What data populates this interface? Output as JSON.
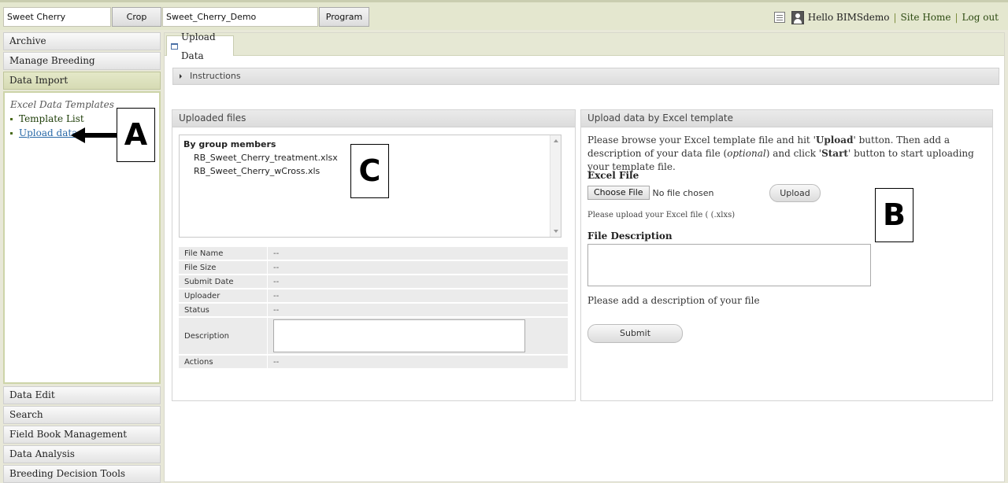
{
  "topbar": {
    "crop_value": "Sweet Cherry",
    "crop_button": "Crop",
    "program_value": "Sweet_Cherry_Demo",
    "program_button": "Program",
    "greeting": "Hello BIMSdemo",
    "separator": "|",
    "site_home": "Site Home",
    "log_out": "Log out"
  },
  "sidebar": {
    "archive": "Archive",
    "manage_breeding": "Manage Breeding",
    "data_import": "Data Import",
    "panel_title": "Excel Data Templates",
    "template_list": "Template List",
    "upload_data": "Upload data",
    "data_edit": "Data Edit",
    "search": "Search",
    "field_book": "Field Book Management",
    "data_analysis": "Data Analysis",
    "breeding_decision": "Breeding Decision Tools"
  },
  "main": {
    "tab_label": "Upload Data",
    "instructions": "Instructions",
    "uploaded_files": {
      "header": "Uploaded files",
      "group": "By group members",
      "files": [
        "RB_Sweet_Cherry_treatment.xlsx",
        "RB_Sweet_Cherry_wCross.xls"
      ]
    },
    "info": {
      "file_name": "File Name",
      "file_size": "File Size",
      "submit_date": "Submit Date",
      "uploader": "Uploader",
      "status": "Status",
      "description": "Description",
      "actions": "Actions",
      "empty": "--"
    },
    "upload_panel": {
      "header": "Upload data by Excel template",
      "intro_1": "Please browse your Excel template file and hit '",
      "intro_upload": "Upload",
      "intro_2": "' button. Then add a description of your data file (",
      "intro_optional": "optional",
      "intro_3": ") and click '",
      "intro_start": "Start",
      "intro_4": "' button to start uploading your template file.",
      "excel_file_label": "Excel File",
      "choose_file": "Choose File",
      "no_file": "No file chosen",
      "upload_button": "Upload",
      "upload_hint": "Please upload your Excel file ( (.xlxs)",
      "file_desc_label": "File Description",
      "desc_hint": "Please add a description of your file",
      "submit": "Submit"
    }
  },
  "callouts": {
    "a": "A",
    "b": "B",
    "c": "C"
  },
  "colors": {
    "topbar": "#e4e7cf",
    "active_accent": "#cdd4a8",
    "link": "#2a6aa8",
    "nav_text": "#1d3d07"
  }
}
